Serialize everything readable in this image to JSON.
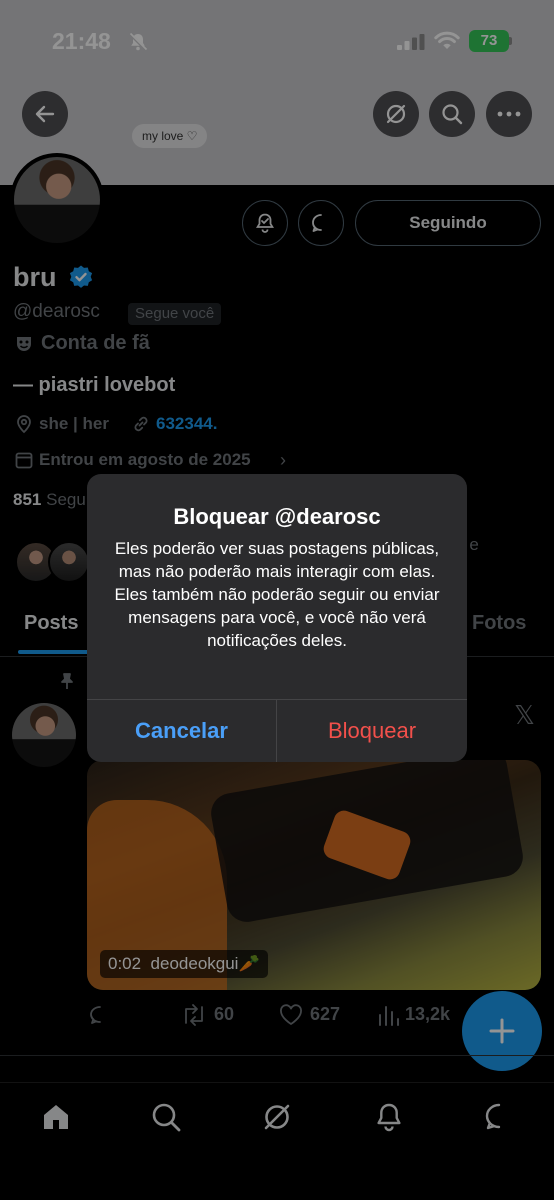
{
  "status_bar": {
    "time": "21:48",
    "battery": "73"
  },
  "banner": {
    "note": "my love ♡"
  },
  "profile": {
    "following_label": "Seguindo",
    "name": "bru",
    "handle": "@dearosc",
    "follows_you": "Segue você",
    "fan_label": "Conta de fã",
    "bio": "— piastri lovebot",
    "location": "she | her",
    "link": "632344.",
    "joined": "Entrou em agosto de 2025",
    "following_count": "851",
    "following_word_partial": "Segu",
    "followers_partial": "¹ e"
  },
  "tabs": {
    "posts": "Posts",
    "photos": "Fotos"
  },
  "post": {
    "media_time": "0:02",
    "media_user": "deodeokgui🥕",
    "retweets": "60",
    "likes": "627",
    "views": "13,2k"
  },
  "dialog": {
    "title": "Bloquear @dearosc",
    "message": "Eles poderão ver suas postagens públicas, mas não poderão mais interagir com elas. Eles também não poderão seguir ou enviar mensagens para você, e você não verá notificações deles.",
    "cancel": "Cancelar",
    "confirm": "Bloquear"
  },
  "colors": {
    "accent": "#1d9bf0",
    "destructive": "#f2504b",
    "ios_link": "#4a9ff8"
  }
}
